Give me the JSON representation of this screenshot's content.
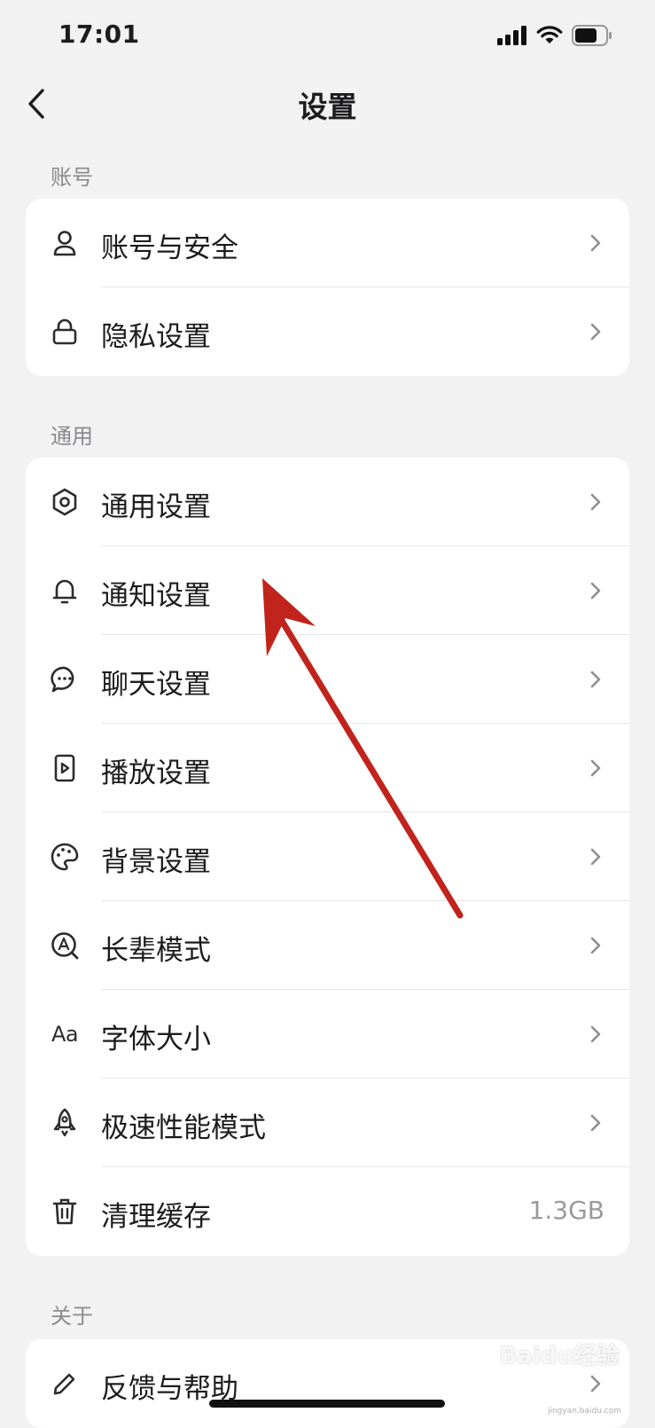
{
  "status_bar": {
    "time": "17:01"
  },
  "nav": {
    "title": "设置"
  },
  "sections": {
    "account": {
      "header": "账号",
      "items": [
        {
          "label": "账号与安全",
          "icon": "user-icon"
        },
        {
          "label": "隐私设置",
          "icon": "lock-icon"
        }
      ]
    },
    "general": {
      "header": "通用",
      "items": [
        {
          "label": "通用设置",
          "icon": "gear-icon"
        },
        {
          "label": "通知设置",
          "icon": "bell-icon"
        },
        {
          "label": "聊天设置",
          "icon": "chat-bubble-icon"
        },
        {
          "label": "播放设置",
          "icon": "play-icon"
        },
        {
          "label": "背景设置",
          "icon": "palette-icon"
        },
        {
          "label": "长辈模式",
          "icon": "elder-mode-icon"
        },
        {
          "label": "字体大小",
          "icon": "font-size-icon",
          "icon_text": "Aa"
        },
        {
          "label": "极速性能模式",
          "icon": "rocket-icon"
        },
        {
          "label": "清理缓存",
          "icon": "trash-icon",
          "value": "1.3GB"
        }
      ]
    },
    "about": {
      "header": "关于",
      "items": [
        {
          "label": "反馈与帮助",
          "icon": "pencil-icon"
        }
      ]
    }
  },
  "watermark": {
    "text": "Baidu经验",
    "sub": "jingyan.baidu.com"
  },
  "annotation": {
    "color": "#c0241c"
  }
}
